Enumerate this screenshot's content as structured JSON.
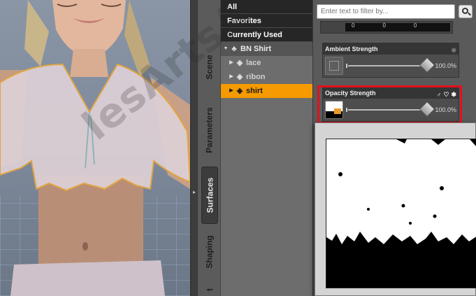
{
  "viewport": {
    "label": "3D viewport render of figure wearing a sheer shirt"
  },
  "side_tabs": [
    {
      "label": "Scene",
      "active": false
    },
    {
      "label": "Parameters",
      "active": false
    },
    {
      "label": "Surfaces",
      "active": true
    },
    {
      "label": "Shaping",
      "active": false
    },
    {
      "label": "t",
      "active": false
    }
  ],
  "tree": {
    "categories": [
      "All",
      "Favorites",
      "Currently Used"
    ],
    "group": {
      "label": "BN Shirt",
      "icon": "figure-icon"
    },
    "items": [
      {
        "label": "lace",
        "selected": false
      },
      {
        "label": "ribon",
        "selected": false
      },
      {
        "label": "shirt",
        "selected": true
      }
    ]
  },
  "filter": {
    "placeholder": "Enter text to filter by..."
  },
  "top_strip": {
    "values": [
      "0",
      "0",
      "0"
    ]
  },
  "properties": [
    {
      "title": "Ambient Strength",
      "value": "100.0%",
      "level": 1.0
    },
    {
      "title": "Opacity Strength",
      "value": "100.0%",
      "level": 1.0
    }
  ],
  "colors": {
    "selected": "#f59a00",
    "highlight": "#e3111d"
  },
  "watermark": "lesArtsAstronautes"
}
